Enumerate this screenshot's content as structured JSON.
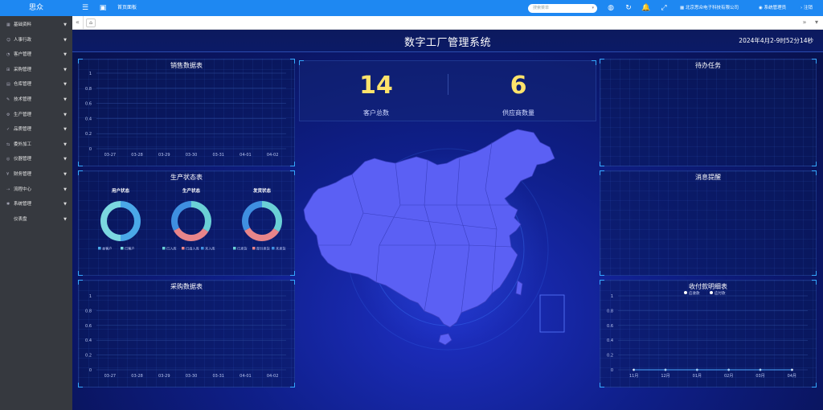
{
  "topbar": {
    "brand": "思众",
    "home_tab": "首页面板",
    "search_placeholder": "搜索菜单",
    "company": "北京思众电子科技有限公司",
    "user": "系统管理员",
    "logout": "注销"
  },
  "sidebar": {
    "items": [
      {
        "label": "基础资料",
        "icon": "grid-icon"
      },
      {
        "label": "人事行政",
        "icon": "people-icon"
      },
      {
        "label": "客户管理",
        "icon": "customer-icon"
      },
      {
        "label": "采购管理",
        "icon": "cart-icon"
      },
      {
        "label": "仓库管理",
        "icon": "warehouse-icon"
      },
      {
        "label": "技术管理",
        "icon": "tech-icon"
      },
      {
        "label": "生产管理",
        "icon": "production-icon"
      },
      {
        "label": "品质管理",
        "icon": "quality-icon"
      },
      {
        "label": "委外加工",
        "icon": "outsource-icon"
      },
      {
        "label": "仪器管理",
        "icon": "instrument-icon"
      },
      {
        "label": "财务管理",
        "icon": "finance-icon"
      },
      {
        "label": "流程中心",
        "icon": "flow-icon"
      },
      {
        "label": "系统管理",
        "icon": "settings-icon"
      },
      {
        "label": "仪表盘",
        "icon": "dashboard-icon"
      }
    ]
  },
  "tabbar": {
    "prev": "«",
    "next": "»"
  },
  "dashboard": {
    "title": "数字工厂管理系统",
    "clock": "2024年4月2-9时52分14秒",
    "sales": {
      "title": "销售数据表",
      "yticks": [
        "1",
        "0.8",
        "0.6",
        "0.4",
        "0.2",
        "0"
      ],
      "xticks": [
        "03-27",
        "03-28",
        "03-29",
        "03-30",
        "03-31",
        "04-01",
        "04-02"
      ]
    },
    "production": {
      "title": "生产状态表",
      "rings": [
        {
          "title": "用户状态",
          "legend": [
            "本客户",
            "已客户"
          ],
          "colors": [
            "#4aa8e8",
            "#7bd8e0"
          ],
          "values": [
            0.5,
            0.5
          ]
        },
        {
          "title": "生产状态",
          "legend": [
            "已入库",
            "已出入库",
            "未入库"
          ],
          "colors": [
            "#6ad0d6",
            "#e8858a",
            "#3f8fe0"
          ],
          "values": [
            0.34,
            0.33,
            0.33
          ]
        },
        {
          "title": "发货状态",
          "legend": [
            "已发货",
            "部分发货",
            "未发货"
          ],
          "colors": [
            "#6ad0d6",
            "#e8858a",
            "#3f8fe0"
          ],
          "values": [
            0.34,
            0.33,
            0.33
          ]
        }
      ]
    },
    "purchase": {
      "title": "采购数据表",
      "yticks": [
        "1",
        "0.8",
        "0.6",
        "0.4",
        "0.2",
        "0"
      ],
      "xticks": [
        "03-27",
        "03-28",
        "03-29",
        "03-30",
        "03-31",
        "04-01",
        "04-02"
      ]
    },
    "stats": [
      {
        "value": "14",
        "label": "客户总数"
      },
      {
        "value": "6",
        "label": "供应商数量"
      }
    ],
    "todo": {
      "title": "待办任务"
    },
    "messages": {
      "title": "消息提醒"
    },
    "payments": {
      "title": "收付款明细表",
      "legend": [
        "应收款",
        "应付款"
      ],
      "yticks": [
        "1",
        "0.8",
        "0.6",
        "0.4",
        "0.2",
        "0"
      ],
      "xticks": [
        "11月",
        "12月",
        "01月",
        "02月",
        "03月",
        "04月"
      ]
    }
  }
}
